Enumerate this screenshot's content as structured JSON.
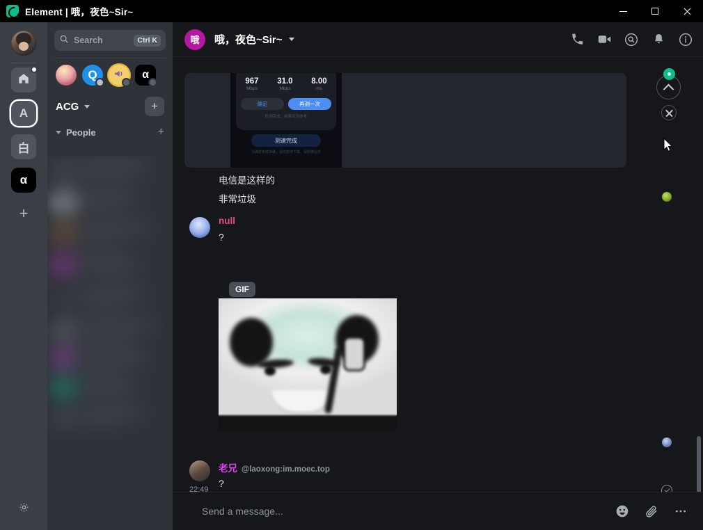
{
  "titlebar": {
    "app_name": "Element",
    "title": "Element | 哦，夜色~Sir~",
    "logo_icon": "element-logo-icon",
    "minimize_label": "Minimize",
    "maximize_label": "Maximize",
    "close_label": "Close"
  },
  "rail": {
    "avatar_label": "User avatar",
    "items": [
      {
        "name": "home-space",
        "label": "",
        "icon": "home-icon",
        "badge": true,
        "selected": false
      },
      {
        "name": "space-a",
        "label": "A",
        "icon": "",
        "badge": false,
        "selected": true
      },
      {
        "name": "space-bai",
        "label": "白",
        "icon": "",
        "badge": false,
        "selected": false
      },
      {
        "name": "space-alpha",
        "label": "α",
        "icon": "",
        "badge": false,
        "selected": false
      }
    ],
    "add_label": "+",
    "settings_icon": "gear-icon"
  },
  "search": {
    "placeholder": "Search",
    "shortcut": "Ctrl K",
    "icon": "search-icon"
  },
  "spaces_row": [
    {
      "name": "space-avatar-anime",
      "badge": "none"
    },
    {
      "name": "space-avatar-q",
      "label": "Q",
      "badge": "dot"
    },
    {
      "name": "space-avatar-megaphone",
      "badge": "muted"
    },
    {
      "name": "space-avatar-alpha",
      "label": "α",
      "badge": "muted"
    }
  ],
  "space_header": {
    "name": "ACG",
    "chevron_icon": "chevron-down-icon",
    "add_label": "+"
  },
  "room_list": {
    "section_title": "People",
    "chevron_icon": "chevron-down-icon",
    "add_label": "+"
  },
  "room_header": {
    "avatar_initial": "哦",
    "avatar_color": "#b5179e",
    "title": "哦，夜色~Sir~",
    "chevron_icon": "chevron-down-icon",
    "icons": [
      {
        "name": "voice-call-icon",
        "label": "Voice call"
      },
      {
        "name": "video-call-icon",
        "label": "Video call"
      },
      {
        "name": "room-search-icon",
        "label": "Search"
      },
      {
        "name": "notifications-bell-icon",
        "label": "Notifications"
      },
      {
        "name": "room-info-icon",
        "label": "Room info"
      }
    ]
  },
  "timeline": {
    "speedtest_image": {
      "alt": "Speed test screenshot",
      "stats": [
        {
          "value": "967",
          "unit": "Mbps"
        },
        {
          "value": "31.0",
          "unit": "Mbps"
        },
        {
          "value": "8.00",
          "unit": "ms"
        }
      ],
      "buttons": [
        "确定",
        "再测一次"
      ],
      "note": "检测完成，结果仅供参考",
      "done_label": "测速完成",
      "footer": "为确定有效准确，请先暂停下载、视频等业务"
    },
    "messages": [
      {
        "name": "message-1",
        "body": "电信是这样的"
      },
      {
        "name": "message-2",
        "body": "非常垃圾"
      }
    ],
    "events": [
      {
        "name": "event-null",
        "sender": "null",
        "sender_color": "#e64e7e",
        "mxid": "",
        "body": "?",
        "timestamp": ""
      },
      {
        "name": "event-laoxong",
        "sender": "老兄",
        "sender_color": "#d946ef",
        "mxid": "@laoxong:im.moec.top",
        "body": "?",
        "timestamp": "22:49"
      }
    ],
    "gif": {
      "badge": "GIF",
      "alt": "Panda meme animated image"
    }
  },
  "controls": {
    "jump_to_bottom_icon": "chevron-up-icon",
    "unread_dot_color": "#0dbd8b",
    "close_icon": "close-icon",
    "scrollbar_name": "timeline-scrollbar"
  },
  "composer": {
    "placeholder": "Send a message...",
    "icons": [
      {
        "name": "emoji-icon",
        "label": "Emoji"
      },
      {
        "name": "attachment-icon",
        "label": "Attachment"
      },
      {
        "name": "more-options-icon",
        "label": "More options"
      }
    ]
  }
}
